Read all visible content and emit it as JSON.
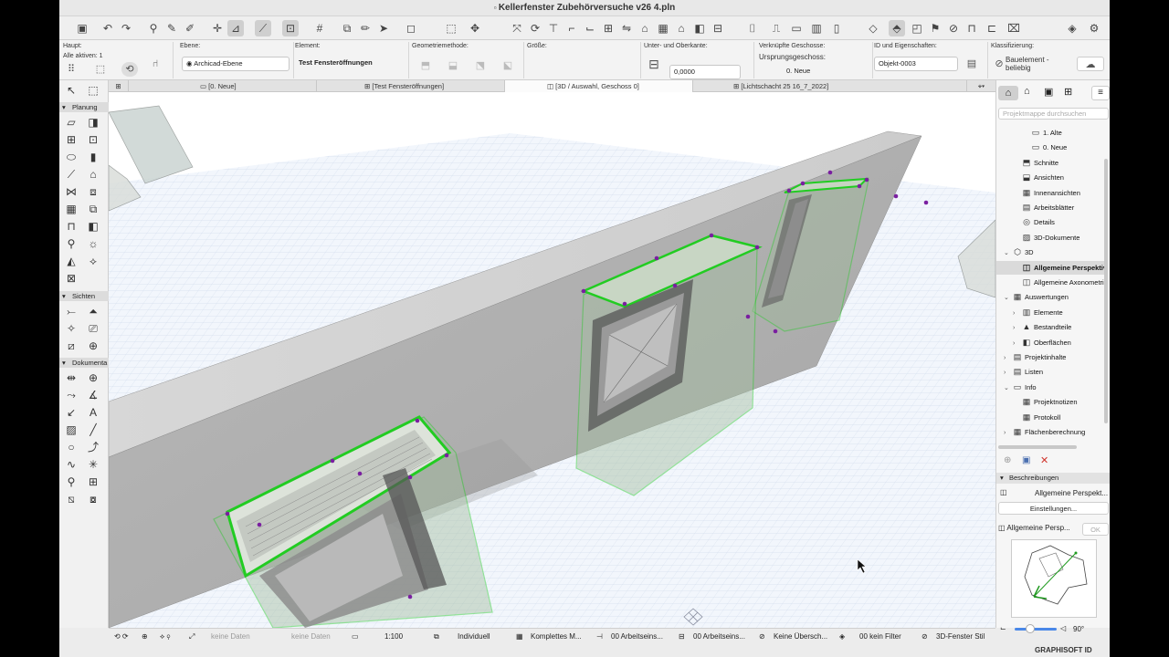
{
  "window": {
    "title": "Kellerfenster Zubehörversuche v26 4.pln"
  },
  "infobox": {
    "haupt_label": "Haupt:",
    "alle_aktiven": "Alle aktiven: 1",
    "ebene_label": "Ebene:",
    "ebene_value": "Archicad-Ebene",
    "element_label": "Element:",
    "element_value": "Test Fensteröffnungen",
    "geometrie_label": "Geometriemethode:",
    "groesse_label": "Größe:",
    "unter_ober_label": "Unter- und Oberkante:",
    "unter_ober_value": "0,0000",
    "geschosse_label": "Verknüpfte Geschosse:",
    "ursprung_label": "Ursprungsgeschoss:",
    "ursprung_value": "0. Neue",
    "id_label": "ID und Eigenschaften:",
    "id_value": "Objekt-0003",
    "klass_label": "Klassifizierung:",
    "klass_value": "Bauelement - beliebig"
  },
  "tabs": [
    {
      "label": "[0. Neue]",
      "icon": "floorplan-icon"
    },
    {
      "label": "[Test Fensteröffnungen]",
      "icon": "section-icon"
    },
    {
      "label": "[3D / Auswahl, Geschoss 0]",
      "icon": "3d-icon"
    },
    {
      "label": "[Lichtschacht 25 16_7_2022]",
      "icon": "section-icon"
    }
  ],
  "toolbox": {
    "section_planung": "Planung",
    "section_sichten": "Sichten",
    "section_dokumente": "Dokumenta"
  },
  "navigator": {
    "search_placeholder": "Projektmappe durchsuchen",
    "items": [
      {
        "label": "1. Alte",
        "indent": 3,
        "icon": "▭",
        "arrow": ""
      },
      {
        "label": "0. Neue",
        "indent": 3,
        "icon": "▭",
        "arrow": ""
      },
      {
        "label": "Schnitte",
        "indent": 2,
        "icon": "⬒",
        "arrow": ""
      },
      {
        "label": "Ansichten",
        "indent": 2,
        "icon": "⬓",
        "arrow": ""
      },
      {
        "label": "Innenansichten",
        "indent": 2,
        "icon": "▦",
        "arrow": ""
      },
      {
        "label": "Arbeitsblätter",
        "indent": 2,
        "icon": "▤",
        "arrow": ""
      },
      {
        "label": "Details",
        "indent": 2,
        "icon": "◎",
        "arrow": ""
      },
      {
        "label": "3D-Dokumente",
        "indent": 2,
        "icon": "▨",
        "arrow": ""
      },
      {
        "label": "3D",
        "indent": 1,
        "icon": "⬡",
        "arrow": "⌄"
      },
      {
        "label": "Allgemeine Perspektive",
        "indent": 2,
        "icon": "◫",
        "arrow": "",
        "selected": true
      },
      {
        "label": "Allgemeine Axonometrie",
        "indent": 2,
        "icon": "◫",
        "arrow": ""
      },
      {
        "label": "Auswertungen",
        "indent": 1,
        "icon": "▦",
        "arrow": "⌄"
      },
      {
        "label": "Elemente",
        "indent": 2,
        "icon": "▥",
        "arrow": "›"
      },
      {
        "label": "Bestandteile",
        "indent": 2,
        "icon": "▲",
        "arrow": "›"
      },
      {
        "label": "Oberflächen",
        "indent": 2,
        "icon": "◧",
        "arrow": "›"
      },
      {
        "label": "Projektinhalte",
        "indent": 1,
        "icon": "▤",
        "arrow": "›"
      },
      {
        "label": "Listen",
        "indent": 1,
        "icon": "▤",
        "arrow": "›"
      },
      {
        "label": "Info",
        "indent": 1,
        "icon": "▭",
        "arrow": "⌄"
      },
      {
        "label": "Projektnotizen",
        "indent": 2,
        "icon": "▦",
        "arrow": ""
      },
      {
        "label": "Protokoll",
        "indent": 2,
        "icon": "▦",
        "arrow": ""
      },
      {
        "label": "Flächenberechnung",
        "indent": 1,
        "icon": "▦",
        "arrow": "›"
      }
    ],
    "beschreibungen": "Beschreibungen",
    "view_name": "Allgemeine Perspekt...",
    "settings_button": "Einstellungen...",
    "preview_name": "Allgemeine Persp...",
    "ok_button": "OK",
    "angle": "90°"
  },
  "statusbar": {
    "keine_daten_1": "keine Daten",
    "keine_daten_2": "keine Daten",
    "scale": "1:100",
    "individuell": "Individuell",
    "komplettes": "Komplettes M...",
    "arbeitsein_1": "00 Arbeitseins...",
    "arbeitsein_2": "00 Arbeitseins...",
    "keine_ueber": "Keine Übersch...",
    "filter": "00 kein Filter",
    "fenster_stil": "3D-Fenster Stil"
  },
  "brand": "GRAPHISOFT ID",
  "colors": {
    "selection": "#22cc22",
    "hotspot": "#7a1fa0",
    "grid": "#c9d6ea"
  }
}
